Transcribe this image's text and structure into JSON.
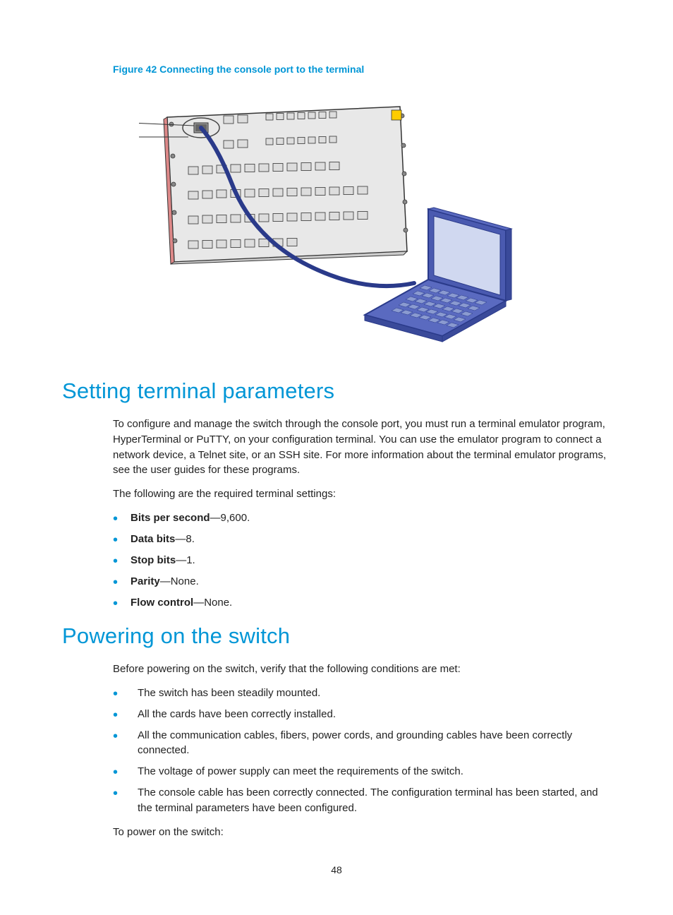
{
  "figure_caption": "Figure 42 Connecting the console port to the terminal",
  "heading1": "Setting terminal parameters",
  "para1": "To configure and manage the switch through the console port, you must run a terminal emulator program, HyperTerminal or PuTTY, on your configuration terminal. You can use the emulator program to connect a network device, a Telnet site, or an SSH site. For more information about the terminal emulator programs, see the user guides for these programs.",
  "para2": "The following are the required terminal settings:",
  "settings": [
    {
      "label": "Bits per second",
      "value": "—9,600."
    },
    {
      "label": "Data bits",
      "value": "—8."
    },
    {
      "label": "Stop bits",
      "value": "—1."
    },
    {
      "label": "Parity",
      "value": "—None."
    },
    {
      "label": "Flow control",
      "value": "—None."
    }
  ],
  "heading2": "Powering on the switch",
  "para3": "Before powering on the switch, verify that the following conditions are met:",
  "conditions": [
    "The switch has been steadily mounted.",
    "All the cards have been correctly installed.",
    "All the communication cables, fibers, power cords, and grounding cables have been correctly connected.",
    "The voltage of power supply can meet the requirements of the switch.",
    "The console cable has been correctly connected. The configuration terminal has been started, and the terminal parameters have been configured."
  ],
  "para4": "To power on the switch:",
  "page_number": "48"
}
